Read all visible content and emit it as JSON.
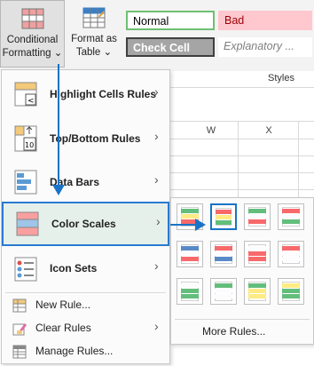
{
  "ribbon": {
    "conditional_formatting": {
      "line1": "Conditional",
      "line2": "Formatting",
      "chevron": "⌄"
    },
    "format_as_table": {
      "line1": "Format as",
      "line2": "Table",
      "chevron": "⌄"
    },
    "styles": [
      {
        "label": "Normal",
        "bg": "#ffffff",
        "fg": "#000000",
        "border": "#6fbf73"
      },
      {
        "label": "Bad",
        "bg": "#ffc7ce",
        "fg": "#9c0006",
        "border": "#ffc7ce"
      },
      {
        "label": "Check Cell",
        "bg": "#a5a5a5",
        "fg": "#ffffff",
        "border": "#3f3f3f"
      },
      {
        "label": "Explanatory ...",
        "bg": "#ffffff",
        "fg": "#7f7f7f",
        "border": "#ffffff"
      }
    ],
    "styles_group_label": "Styles"
  },
  "sheet": {
    "columns": [
      "W",
      "X"
    ]
  },
  "menu": {
    "items": [
      {
        "label": "Highlight Cells Rules",
        "icon": "highlight-cells-icon",
        "arrow": "›"
      },
      {
        "label": "Top/Bottom Rules",
        "icon": "top-bottom-icon",
        "arrow": "›"
      },
      {
        "label": "Data Bars",
        "icon": "data-bars-icon",
        "arrow": "›"
      },
      {
        "label": "Color Scales",
        "icon": "color-scales-icon",
        "arrow": "›"
      },
      {
        "label": "Icon Sets",
        "icon": "icon-sets-icon",
        "arrow": "›"
      }
    ],
    "small_items": [
      {
        "label": "New Rule...",
        "icon": "new-rule-icon"
      },
      {
        "label": "Clear Rules",
        "icon": "clear-rules-icon",
        "arrow": "›"
      },
      {
        "label": "Manage Rules...",
        "icon": "manage-rules-icon"
      }
    ]
  },
  "submenu": {
    "more_rules": "More Rules...",
    "selected_index": 1,
    "swatches": [
      [
        "#63be7b",
        "#ffeb84",
        "#f8696b"
      ],
      [
        "#f8696b",
        "#ffeb84",
        "#63be7b"
      ],
      [
        "#63be7b",
        "#fcfcff",
        "#f8696b"
      ],
      [
        "#f8696b",
        "#fcfcff",
        "#63be7b"
      ],
      [
        "#5a8ac6",
        "#fcfcff",
        "#f8696b"
      ],
      [
        "#f8696b",
        "#fcfcff",
        "#5a8ac6"
      ],
      [
        "#fcfcff",
        "#f8696b",
        "#f8696b"
      ],
      [
        "#f8696b",
        "#fcfcff",
        "#fcfcff"
      ],
      [
        "#fcfcff",
        "#63be7b",
        "#63be7b"
      ],
      [
        "#63be7b",
        "#fcfcff",
        "#fcfcff"
      ],
      [
        "#63be7b",
        "#ffeb84",
        "#ffeb84"
      ],
      [
        "#ffeb84",
        "#63be7b",
        "#63be7b"
      ]
    ]
  }
}
